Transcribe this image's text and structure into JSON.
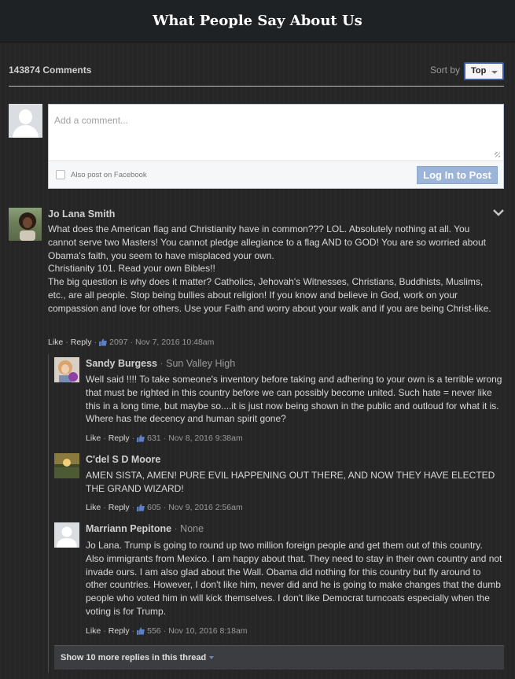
{
  "header": {
    "title": "What People Say About Us"
  },
  "toolbar": {
    "count": "143874 Comments",
    "sort_label": "Sort by",
    "sort_value": "Top"
  },
  "composer": {
    "placeholder": "Add a comment...",
    "facebook_label": "Also post on Facebook",
    "login_label": "Log In to Post"
  },
  "comments": [
    {
      "name": "Jo Lana Smith",
      "affiliation": "",
      "text": "What does the American flag and Christianity have in common??? LOL. Absolutely nothing at all. You cannot serve two Masters! You cannot pledge allegiance to a flag AND to GOD! You are so worried about Obama's faith, you seem to have misplaced your own.\nChristianity 101. Read your own Bibles!!\nThe big question is why does it matter? Catholics, Jehovah's Witnesses, Christians, Buddhists, Muslims, etc., are all people. Stop being bullies about religion! If you know and believe in God, work on your compassion and love for others. Use your Faith and worry about your walk and if you are being Christ-like.",
      "like": "Like",
      "reply": "Reply",
      "likes": "2097",
      "date": "Nov 7, 2016 10:48am"
    },
    {
      "name": "Sandy Burgess",
      "affiliation": "Sun Valley High",
      "text": "Well said !!!! To take someone's inventory before taking and adhering to your own is a terrible wrong that must be righted in this country before we can possibly become united. Such hate = never like this in a long time, but maybe so....it is just now being shown in the public and outloud for what it is. Where has the decency and human spirit gone?",
      "like": "Like",
      "reply": "Reply",
      "likes": "631",
      "date": "Nov 8, 2016 9:38am"
    },
    {
      "name": "C'del S D Moore",
      "affiliation": "",
      "text": "AMEN SISTA, AMEN! PURE EVIL HAPPENING OUT THERE, AND NOW THEY HAVE ELECTED THE GRAND WIZARD!",
      "like": "Like",
      "reply": "Reply",
      "likes": "605",
      "date": "Nov 9, 2016 2:56am"
    },
    {
      "name": "Marriann Pepitone",
      "affiliation": "None",
      "text": "Jo Lana. Trump is going to round up two million foreign people and get them out of this country. Also immigrants from Mexico. I am happy about that. They need to stay in their own country and not invade ours. I am also glad about the Wall. Obama did nothing for this country but fly around to other countries. However, I don't like him, never did and he is going to make changes that the dumb people who voted him in will kick themselves. I don't like Democrat turncoats especially when the voting is for Trump.",
      "like": "Like",
      "reply": "Reply",
      "likes": "556",
      "date": "Nov 10, 2016 8:18am"
    }
  ],
  "more_replies": "Show 10 more replies in this thread",
  "colors": {
    "background": "#262626",
    "header_bg": "#1f2224",
    "login_button": "#9cb4d8",
    "sort_border": "#3b5ca8",
    "like_icon": "#5b7fc7"
  },
  "icons": [
    "avatar-silhouette-icon",
    "thumbs-up-icon",
    "chevron-down-icon",
    "dropdown-caret-icon"
  ]
}
